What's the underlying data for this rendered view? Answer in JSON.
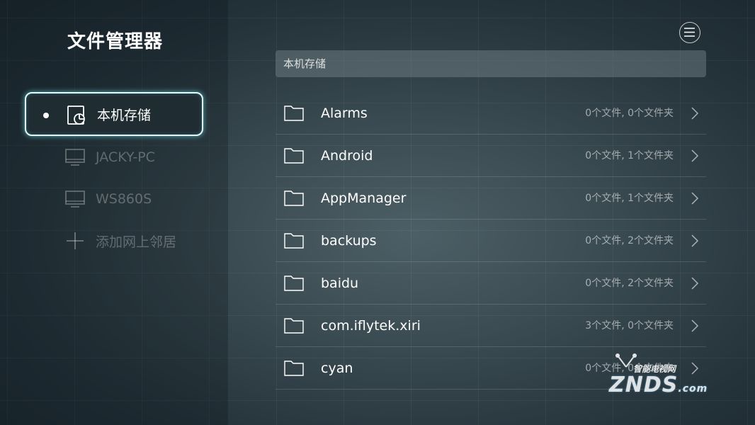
{
  "app": {
    "title": "文件管理器"
  },
  "sidebar": {
    "items": [
      {
        "label": "本机存储",
        "icon": "storage-pie-icon",
        "active": true
      },
      {
        "label": "JACKY-PC",
        "icon": "monitor-icon",
        "active": false
      },
      {
        "label": "WS860S",
        "icon": "monitor-icon",
        "active": false
      },
      {
        "label": "添加网上邻居",
        "icon": "plus-icon",
        "active": false
      }
    ]
  },
  "header": {
    "menu_icon": "hamburger-menu-icon"
  },
  "path_bar": {
    "text": "本机存储"
  },
  "files": [
    {
      "name": "Alarms",
      "meta": "0个文件, 0个文件夹"
    },
    {
      "name": "Android",
      "meta": "0个文件, 1个文件夹"
    },
    {
      "name": "AppManager",
      "meta": "0个文件, 1个文件夹"
    },
    {
      "name": "backups",
      "meta": "0个文件, 2个文件夹"
    },
    {
      "name": "baidu",
      "meta": "0个文件, 2个文件夹"
    },
    {
      "name": "com.iflytek.xiri",
      "meta": "3个文件, 0个文件夹"
    },
    {
      "name": "cyan",
      "meta": "0个文件, 0个文件夹"
    }
  ],
  "watermark": {
    "cn": "智能电视网",
    "en": "ZNDS",
    "domain": ".com"
  },
  "colors": {
    "accent_glow": "#dffcff"
  }
}
